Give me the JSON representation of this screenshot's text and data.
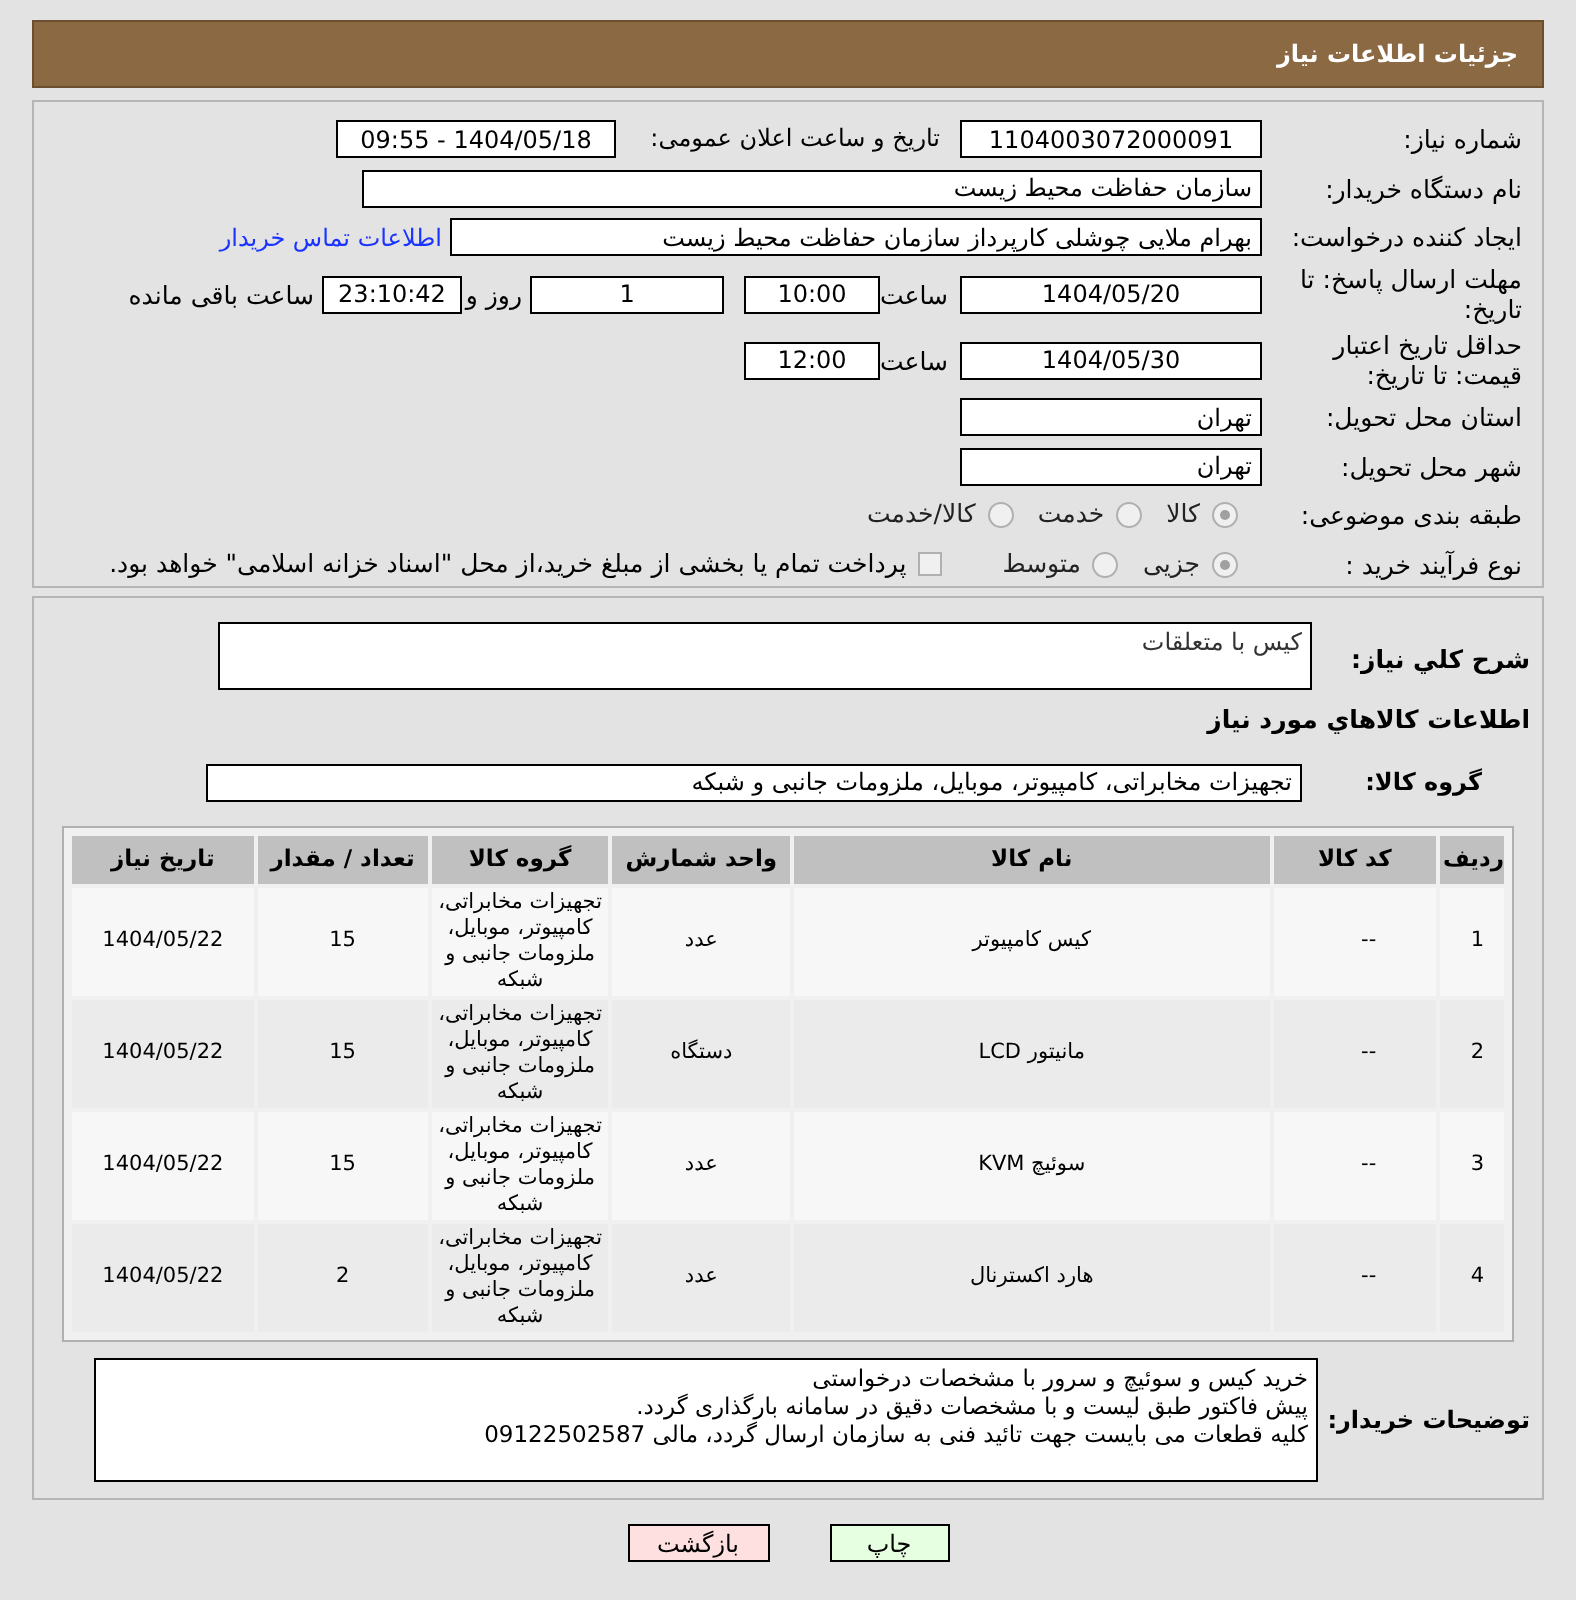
{
  "header": {
    "title": "جزئیات اطلاعات نیاز"
  },
  "need_number": {
    "label": "شماره نیاز:",
    "value": "1104003072000091"
  },
  "announce": {
    "label": "تاریخ و ساعت اعلان عمومی:",
    "value": "1404/05/18 - 09:55"
  },
  "buyer": {
    "label": "نام دستگاه خریدار:",
    "value": "سازمان حفاظت محیط زیست"
  },
  "requester": {
    "label": "ایجاد کننده درخواست:",
    "value": "بهرام ملایی چوشلی کارپرداز سازمان حفاظت محیط زیست",
    "link": "اطلاعات تماس خریدار"
  },
  "deadline": {
    "label": "مهلت ارسال پاسخ: تا تاریخ:",
    "date": "1404/05/20",
    "time_label": "ساعت",
    "time": "10:00",
    "days": "1",
    "days_label": "روز و",
    "remaining": "23:10:42",
    "remaining_label": "ساعت باقی مانده"
  },
  "validity": {
    "label": "حداقل تاریخ اعتبار قیمت: تا تاریخ:",
    "date": "1404/05/30",
    "time_label": "ساعت",
    "time": "12:00"
  },
  "province": {
    "label": "استان محل تحویل:",
    "value": "تهران"
  },
  "city": {
    "label": "شهر محل تحویل:",
    "value": "تهران"
  },
  "category": {
    "label": "طبقه بندی موضوعی:",
    "options": [
      {
        "label": "کالا",
        "selected": true
      },
      {
        "label": "خدمت",
        "selected": false
      },
      {
        "label": "کالا/خدمت",
        "selected": false
      }
    ]
  },
  "process": {
    "label": "نوع فرآیند خرید :",
    "options": [
      {
        "label": "جزیی",
        "selected": true
      },
      {
        "label": "متوسط",
        "selected": false
      }
    ],
    "treasury": {
      "checked": false,
      "label": "پرداخت تمام یا بخشی از مبلغ خرید،از محل \"اسناد خزانه اسلامی\" خواهد بود."
    }
  },
  "description": {
    "label": "شرح کلي نياز:",
    "value": "کیس با متعلقات"
  },
  "goods_title": "اطلاعات کالاهاي مورد نياز",
  "goods_group": {
    "label": "گروه کالا:",
    "value": "تجهیزات مخابراتی، کامپیوتر، موبایل، ملزومات جانبی و شبکه"
  },
  "table": {
    "columns": [
      "ردیف",
      "کد کالا",
      "نام کالا",
      "واحد شمارش",
      "گروه کالا",
      "تعداد / مقدار",
      "تاریخ نیاز"
    ],
    "rows": [
      [
        "1",
        "--",
        "کیس کامپیوتر",
        "عدد",
        "تجهیزات مخابراتی، کامپیوتر، موبایل، ملزومات جانبی و شبکه",
        "15",
        "1404/05/22"
      ],
      [
        "2",
        "--",
        "مانیتور LCD",
        "دستگاه",
        "تجهیزات مخابراتی، کامپیوتر، موبایل، ملزومات جانبی و شبکه",
        "15",
        "1404/05/22"
      ],
      [
        "3",
        "--",
        "سوئیچ KVM",
        "عدد",
        "تجهیزات مخابراتی، کامپیوتر، موبایل، ملزومات جانبی و شبکه",
        "15",
        "1404/05/22"
      ],
      [
        "4",
        "--",
        "هارد اکسترنال",
        "عدد",
        "تجهیزات مخابراتی، کامپیوتر، موبایل، ملزومات جانبی و شبکه",
        "2",
        "1404/05/22"
      ]
    ]
  },
  "notes": {
    "label": "توضیحات خریدار:",
    "lines": [
      "خرید کیس و سوئیچ و سرور با مشخصات درخواستی",
      "پیش فاکتور طبق لیست و با مشخصات دقیق در سامانه بارگذاری گردد.",
      "کلیه قطعات می بایست جهت تائید فنی به سازمان ارسال گردد، مالی 09122502587"
    ]
  },
  "buttons": [
    {
      "label": "چاپ",
      "kind": "print"
    },
    {
      "label": "بازگشت",
      "kind": "back"
    }
  ]
}
